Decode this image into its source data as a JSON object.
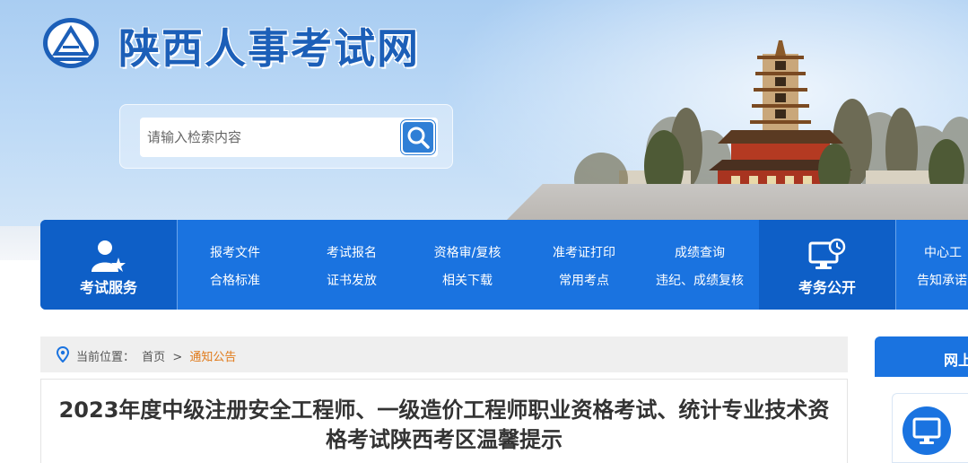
{
  "site": {
    "title": "陕西人事考试网"
  },
  "search": {
    "placeholder": "请输入检索内容"
  },
  "nav": {
    "exam_service_label": "考试服务",
    "exam_affairs_label": "考务公开",
    "links": [
      [
        "报考文件",
        "合格标准"
      ],
      [
        "考试报名",
        "证书发放"
      ],
      [
        "资格审/复核",
        "相关下载"
      ],
      [
        "准考证打印",
        "常用考点"
      ],
      [
        "成绩查询",
        "违纪、成绩复核"
      ]
    ],
    "extra_links": [
      "中心工",
      "告知承诺"
    ]
  },
  "breadcrumb": {
    "prefix": "当前位置：",
    "home": "首页",
    "sep": ">",
    "current": "通知公告"
  },
  "article": {
    "title": "2023年度中级注册安全工程师、一级造价工程师职业资格考试、统计专业技术资格考试陕西考区温馨提示"
  },
  "sidebar": {
    "heading": "网上"
  },
  "colors": {
    "nav_blue": "#1a73e0",
    "nav_dark": "#0e5fc7",
    "title_blue": "#1c5fb8",
    "crumb_current": "#e07a1a"
  }
}
